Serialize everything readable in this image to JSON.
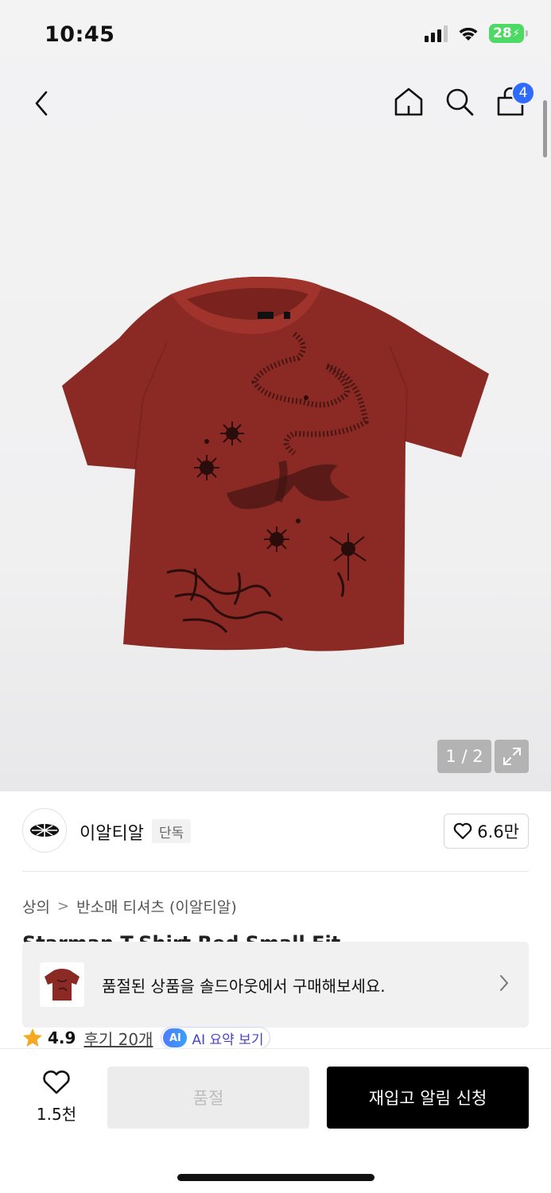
{
  "status_bar": {
    "time": "10:45",
    "battery": "28"
  },
  "nav": {
    "cart_count": "4"
  },
  "gallery": {
    "pager": "1 / 2"
  },
  "brand": {
    "name": "이알티알",
    "tag": "단독",
    "likes": "6.6만"
  },
  "breadcrumb": {
    "items": [
      "상의",
      "반소매 티셔츠 (이알티알)"
    ]
  },
  "title_peek": "Starman T-Shirt Red Small Fit",
  "sold_banner": {
    "text": "품절된 상품을 솔드아웃에서 구매해보세요."
  },
  "rating": {
    "value": "4.9",
    "reviews": "후기 20개",
    "ai_badge": "AI",
    "ai_label": "AI 요약 보기"
  },
  "bottom": {
    "wish_count": "1.5천",
    "soldout_label": "품절",
    "restock_label": "재입고 알림 신청"
  },
  "colors": {
    "accent_blue": "#2f6bff",
    "battery_green": "#4cd964",
    "shirt_red": "#8b2a24"
  }
}
